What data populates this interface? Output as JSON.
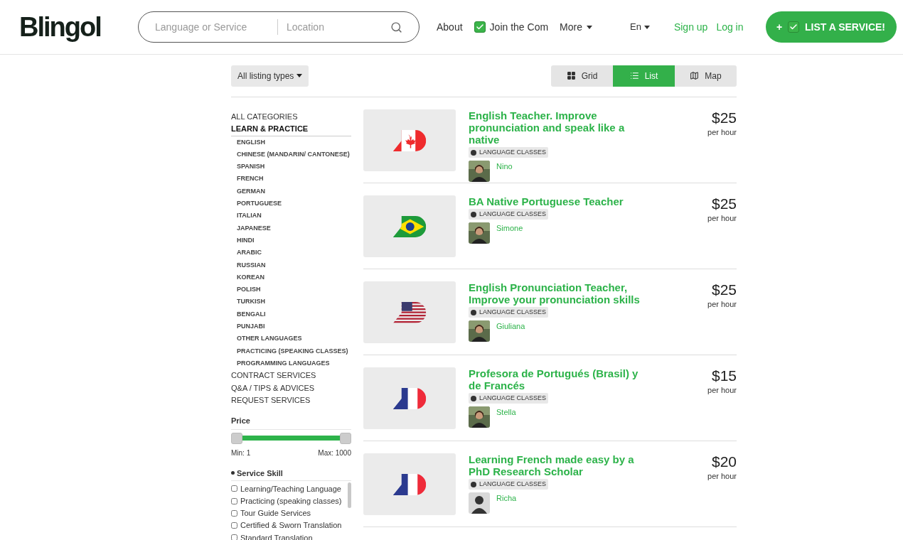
{
  "header": {
    "logo": "Blingol",
    "search": {
      "service_placeholder": "Language or Service",
      "location_placeholder": "Location"
    },
    "nav": [
      {
        "label": "About",
        "kind": "link"
      },
      {
        "label": "Join the Com",
        "kind": "check-link"
      },
      {
        "label": "More",
        "kind": "dropdown"
      }
    ],
    "language": "En",
    "auth": [
      "Sign up",
      "Log in"
    ],
    "cta": "+ ",
    "cta_label": "LIST A SERVICE!"
  },
  "toolbar": {
    "listing_type": "All listing types",
    "views": [
      {
        "label": "Grid",
        "kind": "grid",
        "selected": false
      },
      {
        "label": "List",
        "kind": "list",
        "selected": true
      },
      {
        "label": "Map",
        "kind": "map",
        "selected": false
      }
    ]
  },
  "sidebar": {
    "categories": [
      {
        "label": "ALL CATEGORIES",
        "selected": false
      },
      {
        "label": "LEARN & PRACTICE",
        "selected": true,
        "children": [
          {
            "label": "ENGLISH"
          },
          {
            "label": "CHINESE (MANDARIN/ CANTONESE)"
          },
          {
            "label": "SPANISH"
          },
          {
            "label": "FRENCH"
          },
          {
            "label": "GERMAN"
          },
          {
            "label": "PORTUGUESE"
          },
          {
            "label": "ITALIAN"
          },
          {
            "label": "JAPANESE"
          },
          {
            "label": "HINDI"
          },
          {
            "label": "ARABIC"
          },
          {
            "label": "RUSSIAN"
          },
          {
            "label": "KOREAN"
          },
          {
            "label": "POLISH"
          },
          {
            "label": "TURKISH"
          },
          {
            "label": "BENGALI"
          },
          {
            "label": "PUNJABI"
          },
          {
            "label": "OTHER LANGUAGES"
          },
          {
            "label": "PRACTICING (SPEAKING CLASSES)"
          },
          {
            "label": "PROGRAMMING LANGUAGES"
          }
        ]
      },
      {
        "label": "CONTRACT SERVICES",
        "selected": false
      },
      {
        "label": "Q&A / TIPS & ADVICES",
        "selected": false
      },
      {
        "label": "REQUEST SERVICES",
        "selected": false
      }
    ],
    "price": {
      "title": "Price",
      "level": 1,
      "min": "Min: 1",
      "max": "Max: 1000"
    },
    "skill": {
      "title": "Service Skill",
      "options": [
        {
          "label": "Learning/Teaching Language",
          "checked": false
        },
        {
          "label": "Practicing (speaking classes)",
          "checked": false
        },
        {
          "label": "Tour Guide Services",
          "checked": false
        },
        {
          "label": "Certified & Sworn Translation",
          "checked": false
        },
        {
          "label": "Standard Translation",
          "checked": false
        }
      ]
    }
  },
  "listings": [
    {
      "title": "English Teacher. Improve pronunciation and speak like a native",
      "tag": "LANGUAGE CLASSES",
      "kind": "canada",
      "author": "Nino",
      "price": "$25",
      "unit": "per hour"
    },
    {
      "title": "BA Native Portuguese Teacher",
      "tag": "LANGUAGE CLASSES",
      "kind": "brazil",
      "author": "Simone",
      "price": "$25",
      "unit": "per hour"
    },
    {
      "title": "English Pronunciation Teacher, Improve your pronunciation skills",
      "tag": "LANGUAGE CLASSES",
      "kind": "usa",
      "author": "Giuliana",
      "price": "$25",
      "unit": "per hour"
    },
    {
      "title": "Profesora de Portugués (Brasil) y de Francés",
      "tag": "LANGUAGE CLASSES",
      "kind": "france",
      "author": "Stella",
      "price": "$15",
      "unit": "per hour"
    },
    {
      "title": "Learning French made easy by a PhD Research Scholar",
      "tag": "LANGUAGE CLASSES",
      "kind": "france",
      "author": "Richa",
      "avatar": {
        "kind": "silhouette"
      },
      "price": "$20",
      "unit": "per hour"
    }
  ]
}
